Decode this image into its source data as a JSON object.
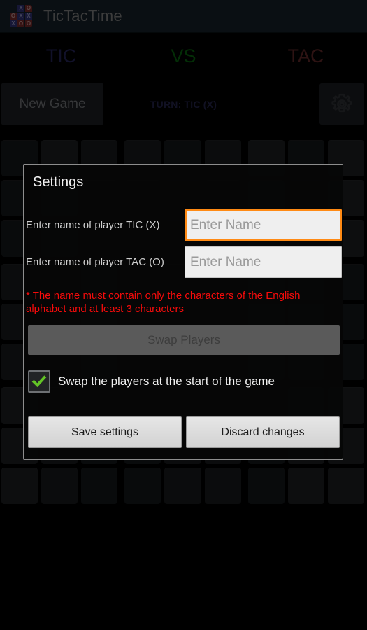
{
  "app": {
    "title": "TicTacTime",
    "logo_icon": "tictactoe-grid-icon",
    "logo_cells": [
      {
        "mark": "",
        "color": "empty"
      },
      {
        "mark": "X",
        "color": "blue"
      },
      {
        "mark": "O",
        "color": "red"
      },
      {
        "mark": "O",
        "color": "red"
      },
      {
        "mark": "X",
        "color": "blue"
      },
      {
        "mark": "X",
        "color": "blue"
      },
      {
        "mark": "X",
        "color": "blue"
      },
      {
        "mark": "O",
        "color": "red"
      },
      {
        "mark": "O",
        "color": "red"
      }
    ]
  },
  "scoreboard": {
    "player_x": "TIC",
    "versus": "VS",
    "player_o": "TAC",
    "color_x": "#2f2f6e",
    "color_vs": "#0a7a12",
    "color_o": "#7a3434"
  },
  "controls": {
    "new_game_label": "New Game",
    "turn_label": "TURN: TIC (X)",
    "turn_color": "#2d2d5e",
    "settings_icon": "gear-icon"
  },
  "dialog": {
    "title": "Settings",
    "label_x": "Enter name of player TIC (X)",
    "label_o": "Enter name of player TAC (O)",
    "input_x_value": "",
    "input_x_placeholder": "Enter Name",
    "input_x_focused": true,
    "input_o_value": "",
    "input_o_placeholder": "Enter Name",
    "input_o_focused": false,
    "focus_border_color": "#ff8a14",
    "hint": "* The name must contain only the characters of the English alphabet and at least 3 characters",
    "hint_color": "#f60b0b",
    "swap_players_label": "Swap Players",
    "swap_players_disabled": true,
    "checkbox_checked": true,
    "checkbox_icon": "checkmark-icon",
    "checkbox_label": "Swap the players at the start of the game",
    "save_label": "Save settings",
    "discard_label": "Discard changes"
  },
  "board": {
    "rows": 9,
    "cols": 9,
    "subgrids": 9,
    "cells_per_subgrid": 9,
    "shades": [
      "d1",
      "d2",
      "d3",
      "d2",
      "d1",
      "d3",
      "d3",
      "d2",
      "d1"
    ]
  }
}
